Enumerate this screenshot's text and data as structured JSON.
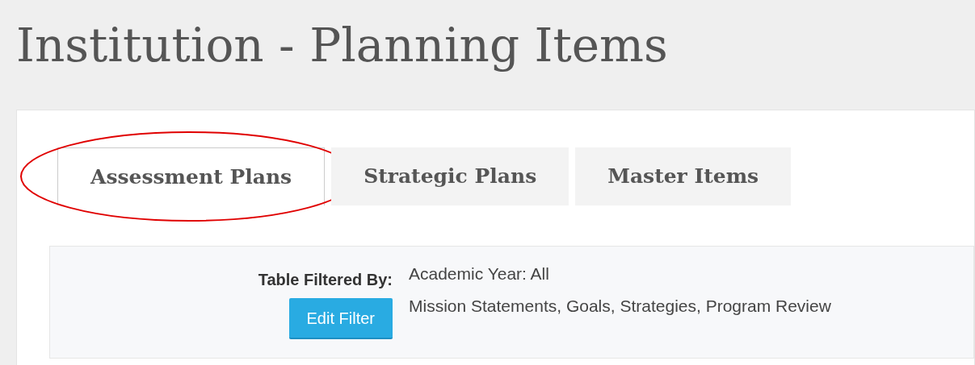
{
  "page_title": "Institution - Planning Items",
  "tabs": [
    {
      "label": "Assessment Plans",
      "selected": true,
      "circled": true
    },
    {
      "label": "Strategic Plans",
      "selected": false,
      "circled": false
    },
    {
      "label": "Master Items",
      "selected": false,
      "circled": false
    }
  ],
  "filter": {
    "label": "Table Filtered By:",
    "button": "Edit Filter",
    "lines": [
      "Academic Year: All",
      "Mission Statements, Goals, Strategies, Program Review"
    ]
  }
}
